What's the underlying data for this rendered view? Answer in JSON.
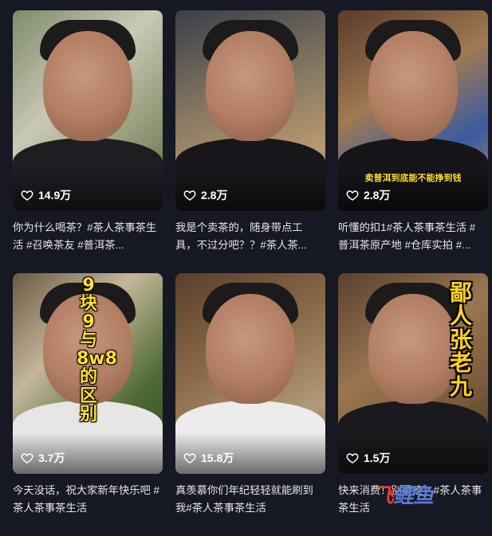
{
  "videos": [
    {
      "likes": "14.9万",
      "caption": "你为什么喝茶？#茶人茶事茶生活 #召唤茶友 #普洱茶..."
    },
    {
      "likes": "2.8万",
      "caption": "我是个卖茶的，随身带点工具，不过分吧？？#茶人茶..."
    },
    {
      "likes": "2.8万",
      "overlay": "卖普洱到底能不能挣到钱",
      "caption": "听懂的扣1#茶人茶事茶生活 #普洱茶原产地 #仓库实拍 #..."
    },
    {
      "likes": "3.7万",
      "overlay": "9块9与8w8的区别",
      "caption": "今天没话，祝大家新年快乐吧 #茶人茶事茶生活"
    },
    {
      "likes": "15.8万",
      "caption": "真羡慕你们年纪轻轻就能刷到我#茶人茶事茶生活"
    },
    {
      "likes": "1.5万",
      "overlay": "鄙人张老九",
      "caption": "快来消费！别墨迹！#茶人茶事茶生活"
    }
  ],
  "watermark": {
    "part1": "飞",
    "part2": "鲤鱼"
  },
  "colors": {
    "background": "#161823",
    "overlay_yellow": "#ffe033"
  }
}
